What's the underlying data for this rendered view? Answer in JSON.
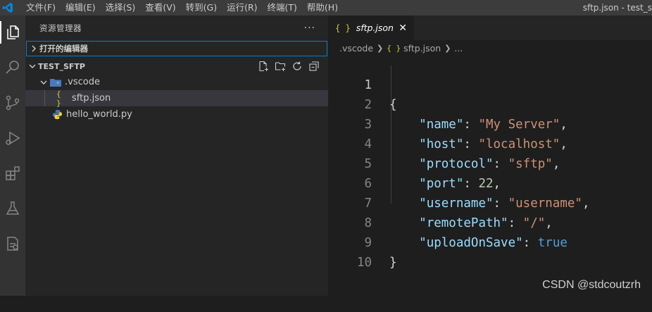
{
  "menu": [
    "文件(F)",
    "编辑(E)",
    "选择(S)",
    "查看(V)",
    "转到(G)",
    "运行(R)",
    "终端(T)",
    "帮助(H)"
  ],
  "window_title": "sftp.json - test_s",
  "activity": [
    "explorer-icon",
    "search-icon",
    "source-control-icon",
    "run-debug-icon",
    "extensions-icon",
    "testing-icon",
    "remote-explorer-icon"
  ],
  "sidebar": {
    "title": "资源管理器",
    "more": "···",
    "open_editors": "打开的编辑器",
    "folder": "TEST_SFTP",
    "tree": [
      {
        "label": ".vscode",
        "type": "folder"
      },
      {
        "label": "sftp.json",
        "type": "json"
      },
      {
        "label": "hello_world.py",
        "type": "python"
      }
    ]
  },
  "editor": {
    "tab": {
      "icon": "{ }",
      "label": "sftp.json",
      "close": "✕"
    },
    "breadcrumb": [
      ".vscode",
      "sftp.json",
      "..."
    ],
    "breadcrumb_icon": "{ }",
    "line_numbers": [
      "1",
      "2",
      "3",
      "4",
      "5",
      "6",
      "7",
      "8",
      "9",
      "10"
    ],
    "code": {
      "open": "{",
      "close": "}",
      "entries": [
        {
          "key": "\"name\"",
          "value": "\"My Server\"",
          "type": "string"
        },
        {
          "key": "\"host\"",
          "value": "\"localhost\"",
          "type": "string"
        },
        {
          "key": "\"protocol\"",
          "value": "\"sftp\"",
          "type": "string"
        },
        {
          "key": "\"port\"",
          "value": "22",
          "type": "number"
        },
        {
          "key": "\"username\"",
          "value": "\"username\"",
          "type": "string"
        },
        {
          "key": "\"remotePath\"",
          "value": "\"/\"",
          "type": "string"
        },
        {
          "key": "\"uploadOnSave\"",
          "value": "true",
          "type": "bool"
        }
      ]
    }
  },
  "watermark": "CSDN @stdcoutzrh",
  "colors": {
    "accent": "#007acc",
    "json_icon": "#cbcb41",
    "key": "#9cdcfe",
    "string": "#ce9178",
    "number": "#b5cea8",
    "bool": "#569cd6"
  }
}
